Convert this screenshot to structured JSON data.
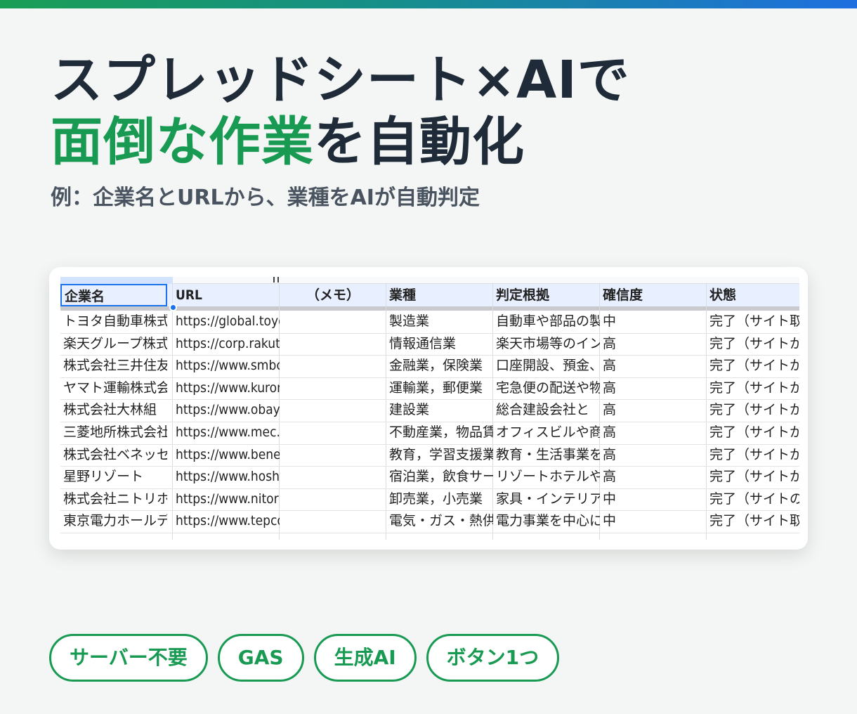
{
  "hero": {
    "line1": "スプレッドシート×AIで",
    "line2_accent": "面倒な作業",
    "line2_rest": "を自動化",
    "subtitle": "例：企業名とURLから、業種をAIが自動判定"
  },
  "sheet": {
    "headers": [
      "企業名",
      "URL",
      "（メモ）",
      "業種",
      "判定根拠",
      "確信度",
      "状態"
    ],
    "rows": [
      [
        "トヨタ自動車株式会社",
        "https://global.toyota/jp/",
        "",
        "製造業",
        "自動車や部品の製造",
        "中",
        "完了（サイト取得"
      ],
      [
        "楽天グループ株式会社",
        "https://corp.rakuten.co.jp/",
        "",
        "情報通信業",
        "楽天市場等のインター",
        "高",
        "完了（サイトから"
      ],
      [
        "株式会社三井住友銀行",
        "https://www.smbc.co.jp/",
        "",
        "金融業，保険業",
        "口座開設、預金、",
        "高",
        "完了（サイトから"
      ],
      [
        "ヤマト運輸株式会社",
        "https://www.kuronekoyamato.co.jp/",
        "",
        "運輸業，郵便業",
        "宅急便の配送や物流",
        "高",
        "完了（サイトから"
      ],
      [
        "株式会社大林組",
        "https://www.obayashi.co.jp/",
        "",
        "建設業",
        "総合建設会社と",
        "高",
        "完了（サイトから"
      ],
      [
        "三菱地所株式会社",
        "https://www.mec.co.jp/",
        "",
        "不動産業，物品賃貸業",
        "オフィスビルや商業",
        "高",
        "完了（サイトから"
      ],
      [
        "株式会社ベネッセ",
        "https://www.benesse-hd.co.jp/",
        "",
        "教育，学習支援業",
        "教育・生活事業を",
        "高",
        "完了（サイトから"
      ],
      [
        "星野リゾート",
        "https://www.hoshinoresorts.com/",
        "",
        "宿泊業，飲食サービス業",
        "リゾートホテルや旅館",
        "高",
        "完了（サイトから"
      ],
      [
        "株式会社ニトリホールディングス",
        "https://www.nitorihd.co.jp/",
        "",
        "卸売業，小売業",
        "家具・インテリア",
        "中",
        "完了（サイトの"
      ],
      [
        "東京電力ホールディングス",
        "https://www.tepco.co.jp/",
        "",
        "電気・ガス・熱供給業",
        "電力事業を中心に",
        "中",
        "完了（サイト取得"
      ]
    ]
  },
  "tags": [
    "サーバー不要",
    "GAS",
    "生成AI",
    "ボタン1つ"
  ],
  "colors": {
    "accent_green": "#189a52",
    "headline_dark": "#1f2b38",
    "selection_blue": "#1a73e8"
  }
}
